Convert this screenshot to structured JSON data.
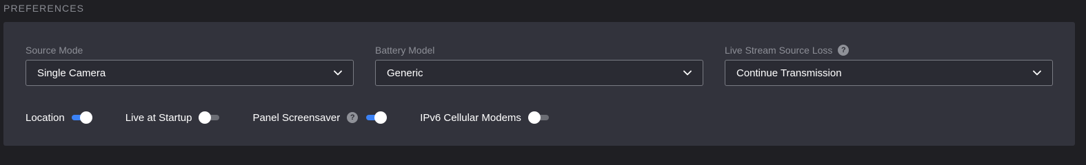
{
  "section": {
    "title": "PREFERENCES"
  },
  "fields": {
    "source_mode": {
      "label": "Source Mode",
      "value": "Single Camera"
    },
    "battery_model": {
      "label": "Battery Model",
      "value": "Generic"
    },
    "live_stream_loss": {
      "label": "Live Stream Source Loss",
      "value": "Continue Transmission",
      "help": "?"
    }
  },
  "toggles": {
    "location": {
      "label": "Location",
      "on": true
    },
    "live_at_startup": {
      "label": "Live at Startup",
      "on": false
    },
    "panel_screensaver": {
      "label": "Panel Screensaver",
      "on": true,
      "help": "?"
    },
    "ipv6_cellular": {
      "label": "IPv6 Cellular Modems",
      "on": false
    }
  },
  "colors": {
    "accent": "#3b82f6",
    "panel": "#32333c",
    "background": "#1f1f23"
  },
  "icons": {
    "dropdown": "chevron-down-icon",
    "help": "help-icon"
  }
}
